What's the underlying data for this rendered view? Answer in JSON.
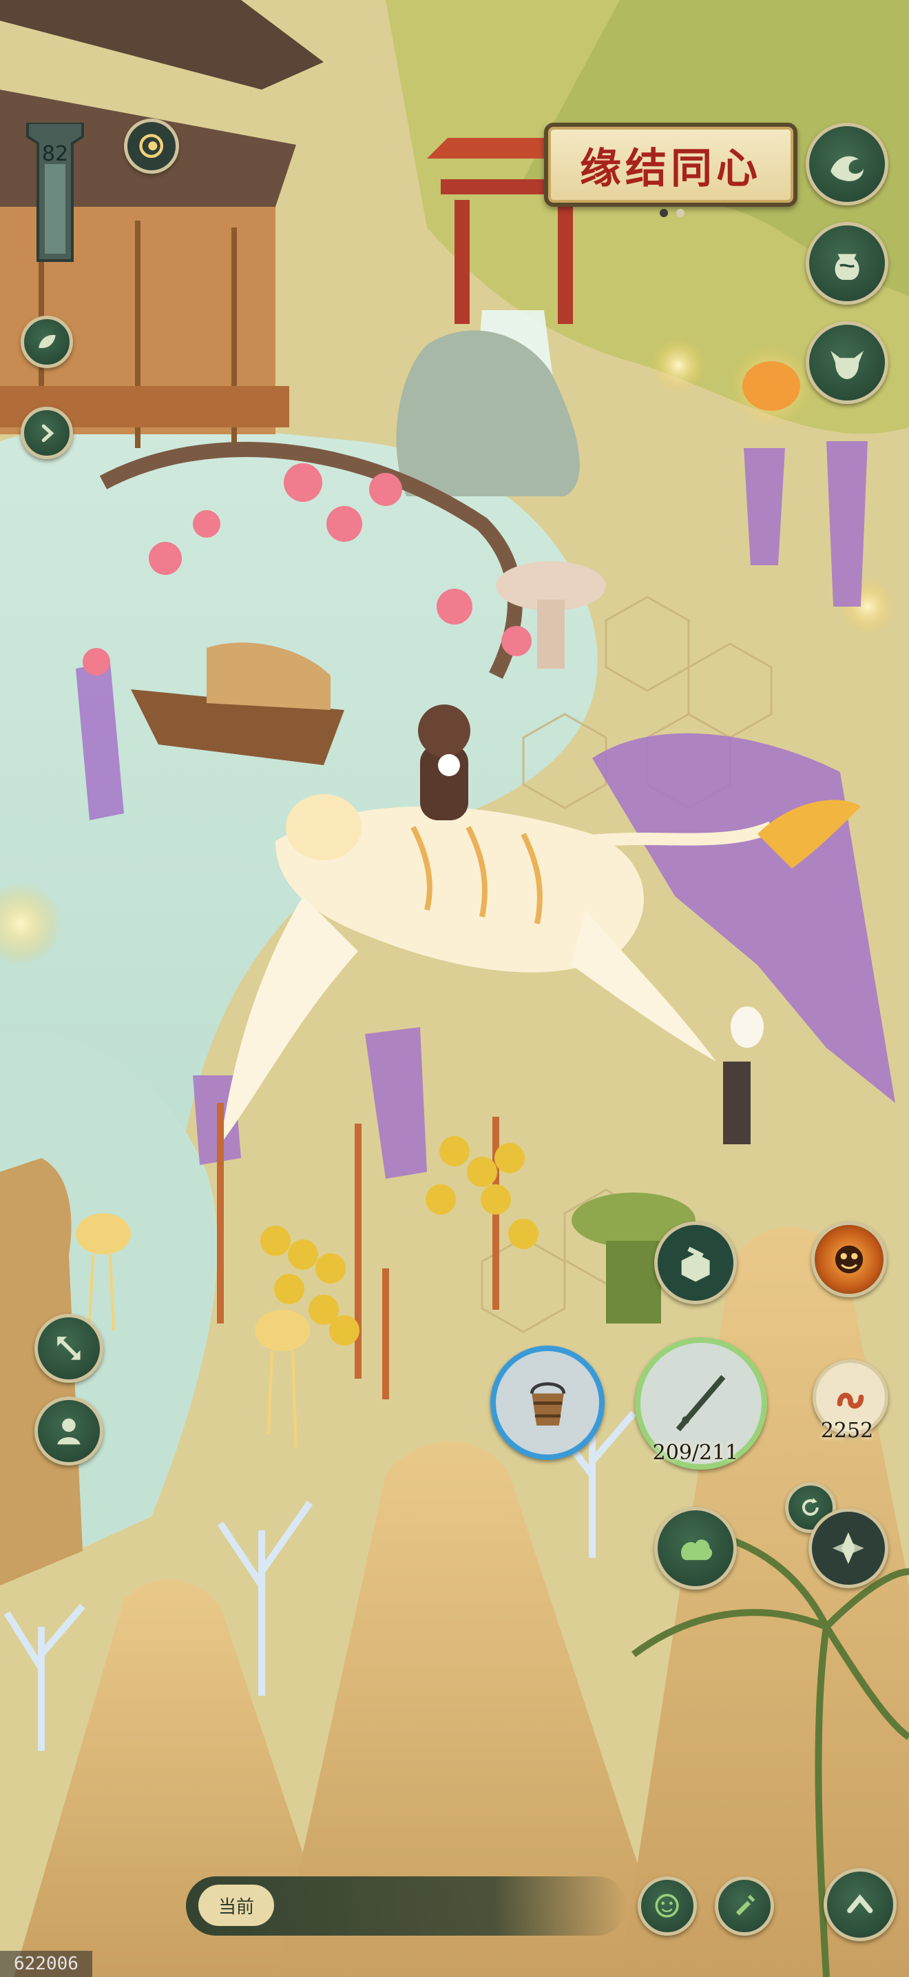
{
  "event_banner": {
    "label": "缘结同心"
  },
  "player": {
    "level": "82"
  },
  "tools": {
    "bait_count": "2252",
    "rod_durability": "209/211"
  },
  "bottom_bar": {
    "current_label": "当前"
  },
  "watermark": "622006",
  "colors": {
    "button_fill": "#2c4f3a",
    "button_ring": "#cfc39b",
    "banner_text": "#a8231c",
    "rod_ring": "#9ad27a",
    "bucket_ring": "#3a9ad8"
  },
  "icons": {
    "right_column": [
      "wave-icon",
      "jar-icon",
      "ox-mask-icon"
    ],
    "left_column": [
      "leaf-icon",
      "chevron-right-icon"
    ],
    "left_lower": [
      "expand-arrows-icon",
      "leaf-person-icon"
    ],
    "tools_row": [
      "bucket-icon",
      "fishing-rod-icon",
      "worm-bait-icon"
    ],
    "action_cluster": [
      "net-box-icon",
      "lion-face-icon",
      "cloud-swirl-icon",
      "refresh-icon",
      "compass-icon"
    ],
    "bottom_right": [
      "smile-face-icon",
      "scroll-quill-icon",
      "chevron-up-icon"
    ]
  }
}
